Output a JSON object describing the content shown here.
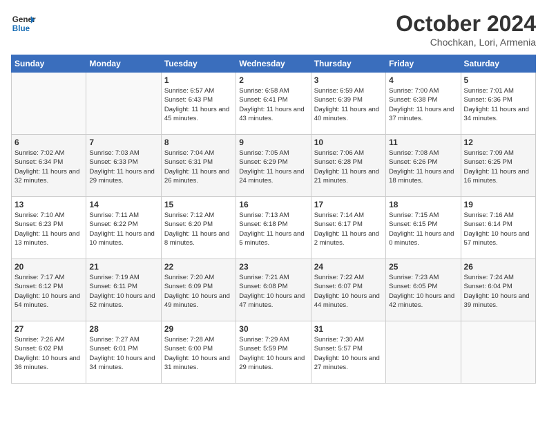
{
  "header": {
    "logo_general": "General",
    "logo_blue": "Blue",
    "month_year": "October 2024",
    "location": "Chochkan, Lori, Armenia"
  },
  "weekdays": [
    "Sunday",
    "Monday",
    "Tuesday",
    "Wednesday",
    "Thursday",
    "Friday",
    "Saturday"
  ],
  "weeks": [
    [
      {
        "day": "",
        "sunrise": "",
        "sunset": "",
        "daylight": ""
      },
      {
        "day": "",
        "sunrise": "",
        "sunset": "",
        "daylight": ""
      },
      {
        "day": "1",
        "sunrise": "Sunrise: 6:57 AM",
        "sunset": "Sunset: 6:43 PM",
        "daylight": "Daylight: 11 hours and 45 minutes."
      },
      {
        "day": "2",
        "sunrise": "Sunrise: 6:58 AM",
        "sunset": "Sunset: 6:41 PM",
        "daylight": "Daylight: 11 hours and 43 minutes."
      },
      {
        "day": "3",
        "sunrise": "Sunrise: 6:59 AM",
        "sunset": "Sunset: 6:39 PM",
        "daylight": "Daylight: 11 hours and 40 minutes."
      },
      {
        "day": "4",
        "sunrise": "Sunrise: 7:00 AM",
        "sunset": "Sunset: 6:38 PM",
        "daylight": "Daylight: 11 hours and 37 minutes."
      },
      {
        "day": "5",
        "sunrise": "Sunrise: 7:01 AM",
        "sunset": "Sunset: 6:36 PM",
        "daylight": "Daylight: 11 hours and 34 minutes."
      }
    ],
    [
      {
        "day": "6",
        "sunrise": "Sunrise: 7:02 AM",
        "sunset": "Sunset: 6:34 PM",
        "daylight": "Daylight: 11 hours and 32 minutes."
      },
      {
        "day": "7",
        "sunrise": "Sunrise: 7:03 AM",
        "sunset": "Sunset: 6:33 PM",
        "daylight": "Daylight: 11 hours and 29 minutes."
      },
      {
        "day": "8",
        "sunrise": "Sunrise: 7:04 AM",
        "sunset": "Sunset: 6:31 PM",
        "daylight": "Daylight: 11 hours and 26 minutes."
      },
      {
        "day": "9",
        "sunrise": "Sunrise: 7:05 AM",
        "sunset": "Sunset: 6:29 PM",
        "daylight": "Daylight: 11 hours and 24 minutes."
      },
      {
        "day": "10",
        "sunrise": "Sunrise: 7:06 AM",
        "sunset": "Sunset: 6:28 PM",
        "daylight": "Daylight: 11 hours and 21 minutes."
      },
      {
        "day": "11",
        "sunrise": "Sunrise: 7:08 AM",
        "sunset": "Sunset: 6:26 PM",
        "daylight": "Daylight: 11 hours and 18 minutes."
      },
      {
        "day": "12",
        "sunrise": "Sunrise: 7:09 AM",
        "sunset": "Sunset: 6:25 PM",
        "daylight": "Daylight: 11 hours and 16 minutes."
      }
    ],
    [
      {
        "day": "13",
        "sunrise": "Sunrise: 7:10 AM",
        "sunset": "Sunset: 6:23 PM",
        "daylight": "Daylight: 11 hours and 13 minutes."
      },
      {
        "day": "14",
        "sunrise": "Sunrise: 7:11 AM",
        "sunset": "Sunset: 6:22 PM",
        "daylight": "Daylight: 11 hours and 10 minutes."
      },
      {
        "day": "15",
        "sunrise": "Sunrise: 7:12 AM",
        "sunset": "Sunset: 6:20 PM",
        "daylight": "Daylight: 11 hours and 8 minutes."
      },
      {
        "day": "16",
        "sunrise": "Sunrise: 7:13 AM",
        "sunset": "Sunset: 6:18 PM",
        "daylight": "Daylight: 11 hours and 5 minutes."
      },
      {
        "day": "17",
        "sunrise": "Sunrise: 7:14 AM",
        "sunset": "Sunset: 6:17 PM",
        "daylight": "Daylight: 11 hours and 2 minutes."
      },
      {
        "day": "18",
        "sunrise": "Sunrise: 7:15 AM",
        "sunset": "Sunset: 6:15 PM",
        "daylight": "Daylight: 11 hours and 0 minutes."
      },
      {
        "day": "19",
        "sunrise": "Sunrise: 7:16 AM",
        "sunset": "Sunset: 6:14 PM",
        "daylight": "Daylight: 10 hours and 57 minutes."
      }
    ],
    [
      {
        "day": "20",
        "sunrise": "Sunrise: 7:17 AM",
        "sunset": "Sunset: 6:12 PM",
        "daylight": "Daylight: 10 hours and 54 minutes."
      },
      {
        "day": "21",
        "sunrise": "Sunrise: 7:19 AM",
        "sunset": "Sunset: 6:11 PM",
        "daylight": "Daylight: 10 hours and 52 minutes."
      },
      {
        "day": "22",
        "sunrise": "Sunrise: 7:20 AM",
        "sunset": "Sunset: 6:09 PM",
        "daylight": "Daylight: 10 hours and 49 minutes."
      },
      {
        "day": "23",
        "sunrise": "Sunrise: 7:21 AM",
        "sunset": "Sunset: 6:08 PM",
        "daylight": "Daylight: 10 hours and 47 minutes."
      },
      {
        "day": "24",
        "sunrise": "Sunrise: 7:22 AM",
        "sunset": "Sunset: 6:07 PM",
        "daylight": "Daylight: 10 hours and 44 minutes."
      },
      {
        "day": "25",
        "sunrise": "Sunrise: 7:23 AM",
        "sunset": "Sunset: 6:05 PM",
        "daylight": "Daylight: 10 hours and 42 minutes."
      },
      {
        "day": "26",
        "sunrise": "Sunrise: 7:24 AM",
        "sunset": "Sunset: 6:04 PM",
        "daylight": "Daylight: 10 hours and 39 minutes."
      }
    ],
    [
      {
        "day": "27",
        "sunrise": "Sunrise: 7:26 AM",
        "sunset": "Sunset: 6:02 PM",
        "daylight": "Daylight: 10 hours and 36 minutes."
      },
      {
        "day": "28",
        "sunrise": "Sunrise: 7:27 AM",
        "sunset": "Sunset: 6:01 PM",
        "daylight": "Daylight: 10 hours and 34 minutes."
      },
      {
        "day": "29",
        "sunrise": "Sunrise: 7:28 AM",
        "sunset": "Sunset: 6:00 PM",
        "daylight": "Daylight: 10 hours and 31 minutes."
      },
      {
        "day": "30",
        "sunrise": "Sunrise: 7:29 AM",
        "sunset": "Sunset: 5:59 PM",
        "daylight": "Daylight: 10 hours and 29 minutes."
      },
      {
        "day": "31",
        "sunrise": "Sunrise: 7:30 AM",
        "sunset": "Sunset: 5:57 PM",
        "daylight": "Daylight: 10 hours and 27 minutes."
      },
      {
        "day": "",
        "sunrise": "",
        "sunset": "",
        "daylight": ""
      },
      {
        "day": "",
        "sunrise": "",
        "sunset": "",
        "daylight": ""
      }
    ]
  ]
}
